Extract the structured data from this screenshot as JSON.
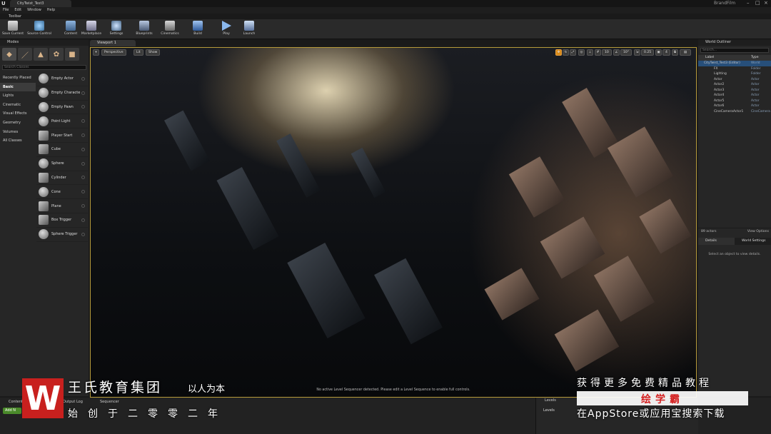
{
  "window": {
    "doc_tab": "CityTwist_Test3",
    "brand": "BrandFilm"
  },
  "menu": [
    "File",
    "Edit",
    "Window",
    "Help"
  ],
  "toolbar": {
    "tab_label": "Toolbar",
    "buttons": [
      {
        "label": "Save Current",
        "icon": "save-icon"
      },
      {
        "label": "Source Control",
        "icon": "source-control-icon"
      },
      {
        "label": "Content",
        "icon": "content-icon"
      },
      {
        "label": "Marketplace",
        "icon": "marketplace-icon"
      },
      {
        "label": "Settings",
        "icon": "settings-icon"
      },
      {
        "label": "Blueprints",
        "icon": "blueprints-icon"
      },
      {
        "label": "Cinematics",
        "icon": "cinematics-icon"
      },
      {
        "label": "Build",
        "icon": "build-icon"
      },
      {
        "label": "Play",
        "icon": "play-icon"
      },
      {
        "label": "Launch",
        "icon": "launch-icon"
      }
    ]
  },
  "modes": {
    "tab_label": "Modes",
    "search_placeholder": "Search Classes",
    "categories": [
      "Recently Placed",
      "Basic",
      "Lights",
      "Cinematic",
      "Visual Effects",
      "Geometry",
      "Volumes",
      "All Classes"
    ],
    "selected_category": "Basic",
    "items": [
      "Empty Actor",
      "Empty Characte",
      "Empty Pawn",
      "Point Light",
      "Player Start",
      "Cube",
      "Sphere",
      "Cylinder",
      "Cone",
      "Plane",
      "Box Trigger",
      "Sphere Trigger"
    ]
  },
  "viewport": {
    "tab_label": "Viewport 1",
    "view_mode": "Perspective",
    "lit_mode": "Lit",
    "show_label": "Show",
    "grid_snap": "10",
    "rot_snap": "10°",
    "scale_snap": "0.25",
    "camera_speed": "4",
    "message": "No active Level Sequencer detected. Please edit a Level Sequence to enable full controls."
  },
  "outliner": {
    "tab_label": "World Outliner",
    "search_placeholder": "Search...",
    "col_label": "Label",
    "col_type": "Type",
    "rows": [
      {
        "label": "CityTwist_Test3 (Editor)",
        "type": "World",
        "selected": true
      },
      {
        "label": "FX",
        "type": "Folder"
      },
      {
        "label": "Lighting",
        "type": "Folder"
      },
      {
        "label": "Actor",
        "type": "Actor"
      },
      {
        "label": "Actor2",
        "type": "Actor"
      },
      {
        "label": "Actor3",
        "type": "Actor"
      },
      {
        "label": "Actor4",
        "type": "Actor"
      },
      {
        "label": "Actor5",
        "type": "Actor"
      },
      {
        "label": "Actor6",
        "type": "Actor"
      },
      {
        "label": "CineCameraActor1",
        "type": "CineCamera"
      }
    ],
    "actor_count": "89 actors",
    "view_options": "View Options"
  },
  "details": {
    "tab_details": "Details",
    "tab_world": "World Settings",
    "empty_message": "Select an object to view details."
  },
  "bottom": {
    "content_tab": "Content",
    "output_tab": "Output Log",
    "sequencer_tab": "Sequencer",
    "add_new": "Add N",
    "levels_tab": "Levels",
    "levels_dropdown": "Levels"
  },
  "overlay": {
    "org_name": "王氏教育集团",
    "motto": "以人为本",
    "founded": "始创于二零零二年",
    "promo_line1": "获得更多免费精品教程",
    "promo_brand": "绘学霸",
    "promo_line3": "在AppStore或应用宝搜索下载",
    "brand_color": "#c8201e"
  }
}
